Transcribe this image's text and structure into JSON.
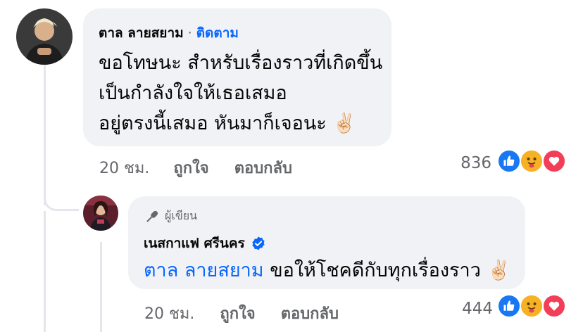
{
  "comment": {
    "author": "ตาล ลายสยาม",
    "follow_label": "ติดตาม",
    "separator": "·",
    "lines": [
      "ขอโทษนะ สำหรับเรื่องราวที่เกิดขึ้น",
      "เป็นกำลังใจให้เธอเสมอ",
      "อยู่ตรงนี้เสมอ หันมาก็เจอนะ"
    ],
    "emoji": "✌🏻",
    "time": "20 ชม.",
    "like_label": "ถูกใจ",
    "reply_label": "ตอบกลับ",
    "reaction_count": "836"
  },
  "reply": {
    "badge_label": "ผู้เขียน",
    "author": "เนสกาแฟ ศรีนคร",
    "mention": "ตาล ลายสยาม",
    "text": "ขอให้โชคดีกับทุกเรื่องราว",
    "emoji": "✌🏻",
    "time": "20 ชม.",
    "like_label": "ถูกใจ",
    "reply_label": "ตอบกลับ",
    "reaction_count": "444"
  },
  "colors": {
    "bubble": "#f0f2f5",
    "link": "#0866ff",
    "muted": "#65676b",
    "like": "#1877f2",
    "love": "#f33e58",
    "care": "#f7b125"
  },
  "icons": [
    "like-icon",
    "care-icon",
    "love-icon",
    "verified-icon",
    "microphone-icon"
  ]
}
